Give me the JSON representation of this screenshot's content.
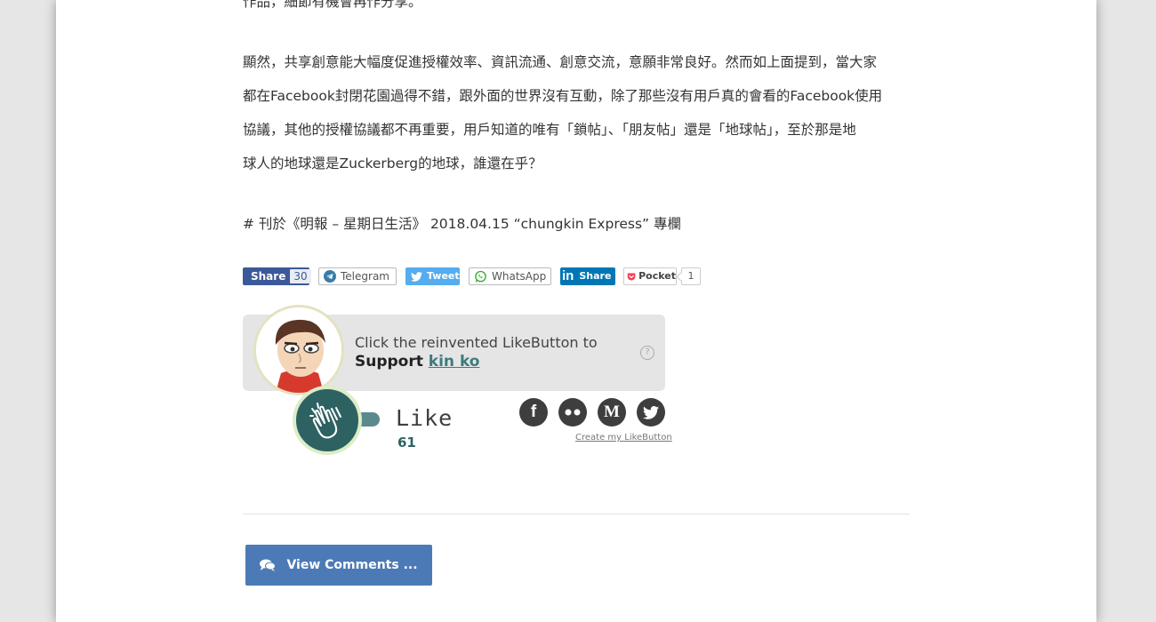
{
  "article": {
    "paragraph_top": "作品，細節有機會再作分享。",
    "paragraph_main_lines": [
      "顯然，共享創意能大幅度促進授權效率、資訊流通、創意交流，意願非常良好。然而如上面提到，當大家",
      "都在Facebook封閉花園過得不錯，跟外面的世界沒有互動，除了那些沒有用戶真的會看的Facebook使用",
      "協議，其他的授權協議都不再重要，用戶知道的唯有「鎖帖」、「朋友帖」還是「地球帖」，至於那是地",
      "球人的地球還是Zuckerberg的地球，誰還在乎？"
    ],
    "credit": "# 刊於《明報 – 星期日生活》 2018.04.15 “chungkin Express” 專欄"
  },
  "share": {
    "facebook_label": "Share",
    "facebook_count": "30",
    "telegram_label": "Telegram",
    "twitter_label": "Tweet",
    "whatsapp_label": "WhatsApp",
    "linkedin_label": "Share",
    "pocket_label": "Pocket",
    "pocket_count": "1"
  },
  "likebutton": {
    "line1": "Click the reinvented LikeButton to",
    "support_word": "Support",
    "author": "kin ko",
    "help": "?",
    "like_word": "Like",
    "like_count": "61",
    "social_icons": [
      "facebook-icon",
      "flickr-icon",
      "medium-icon",
      "twitter-icon"
    ],
    "create_link": "Create my LikeButton"
  },
  "comments": {
    "button_label": "View Comments ..."
  },
  "colors": {
    "facebook": "#3b5998",
    "twitter": "#55acee",
    "linkedin": "#0077b5",
    "pocket": "#ef4056",
    "like_teal": "#2e6262",
    "comments_button": "#4c7ab6"
  }
}
